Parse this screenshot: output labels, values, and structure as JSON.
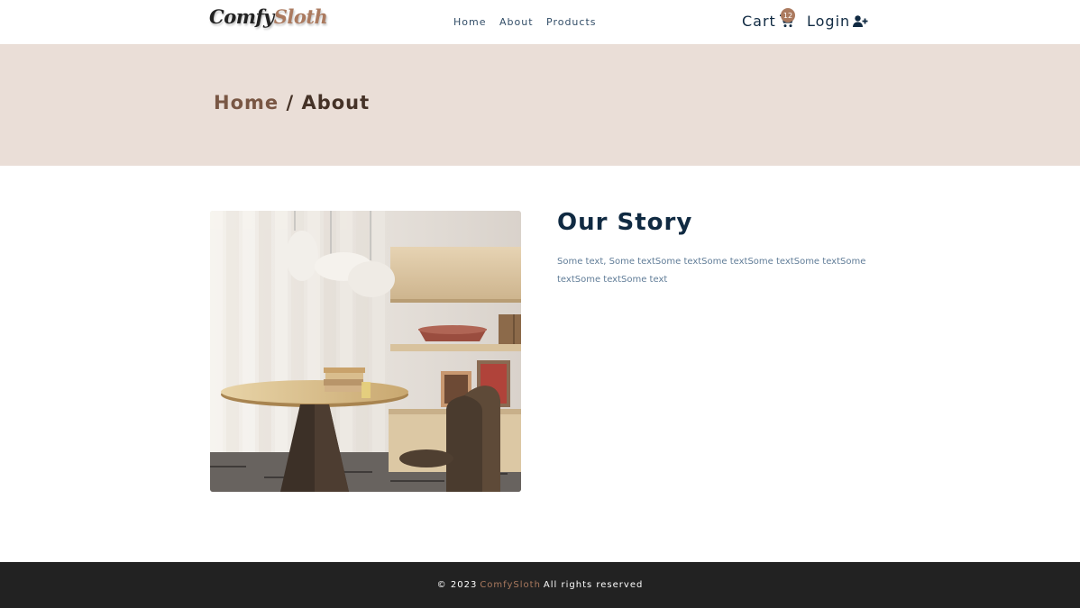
{
  "brand": {
    "part1": "Comfy",
    "part2": "Sloth"
  },
  "nav": {
    "home": "Home",
    "about": "About",
    "products": "Products"
  },
  "header": {
    "cart_label": "Cart",
    "cart_count": "12",
    "login_label": "Login"
  },
  "breadcrumb": {
    "home": "Home",
    "separator": " / ",
    "current": "About"
  },
  "story": {
    "title": "Our Story",
    "text": "Some text, Some textSome textSome textSome textSome textSome textSome textSome text"
  },
  "footer": {
    "prefix": "© 2023",
    "brand": "ComfySloth",
    "suffix": "All rights reserved"
  },
  "colors": {
    "accent": "#ab7a5f",
    "hero_bg": "#eaded7",
    "footer_bg": "#222222",
    "heading": "#102a42"
  },
  "icons": [
    "cart-icon",
    "add-user-icon"
  ]
}
